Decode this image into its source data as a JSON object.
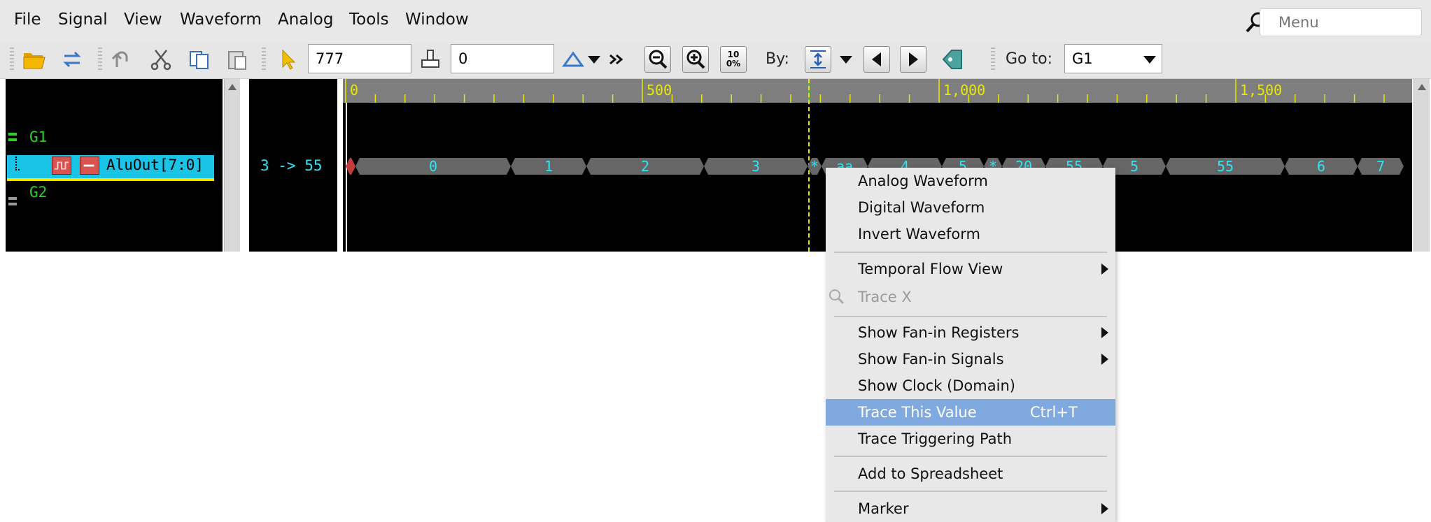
{
  "menubar": {
    "items": [
      "File",
      "Signal",
      "View",
      "Waveform",
      "Analog",
      "Tools",
      "Window"
    ],
    "search_placeholder": "Menu"
  },
  "toolbar": {
    "time_value": "777",
    "delta_value": "0",
    "by_label": "By:",
    "goto_label": "Go to:",
    "goto_value": "G1",
    "zoom_full_label": "100%"
  },
  "signals": {
    "group1": "G1",
    "signal": "AluOut[7:0]",
    "group2": "G2",
    "cursor_value": "3 -> 55"
  },
  "ruler": {
    "ticks": [
      "0",
      "500",
      "1,000",
      "1,500"
    ]
  },
  "waveform": {
    "values": [
      "0",
      "1",
      "2",
      "3",
      "*",
      "aa",
      "4",
      "5",
      "*",
      "20",
      "55",
      "5",
      "55",
      "6",
      "7"
    ]
  },
  "context_menu": {
    "items": [
      {
        "label": "Analog Waveform"
      },
      {
        "label": "Digital Waveform"
      },
      {
        "label": "Invert Waveform"
      },
      {
        "label": "Temporal Flow View"
      },
      {
        "label": "Trace X"
      },
      {
        "label": "Show Fan-in Registers"
      },
      {
        "label": "Show Fan-in Signals"
      },
      {
        "label": "Show Clock (Domain)"
      },
      {
        "label": "Trace This Value",
        "shortcut": "Ctrl+T"
      },
      {
        "label": "Trace Triggering Path"
      },
      {
        "label": "Add to Spreadsheet"
      },
      {
        "label": "Marker"
      }
    ]
  },
  "colors": {
    "wave_text": "#2ee5f5",
    "highlight": "#80a9e0",
    "signal_row": "#19c4e6",
    "ruler_text": "#e8e800",
    "group_text": "#27d427"
  }
}
